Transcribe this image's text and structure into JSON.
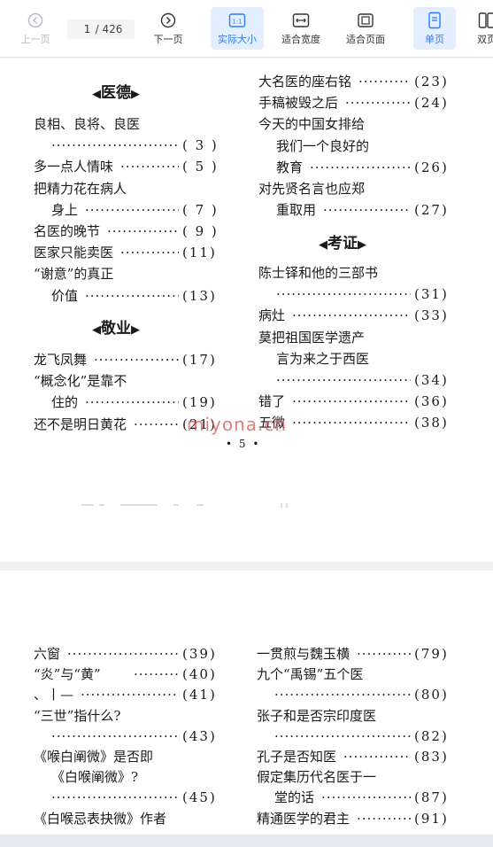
{
  "toolbar": {
    "prev_label": "上一页",
    "next_label": "下一页",
    "page_current": "1",
    "page_total": "/ 426",
    "actual_size_label": "实际大小",
    "fit_width_label": "适合宽度",
    "fit_page_label": "适合页面",
    "single_page_label": "单页",
    "double_page_label": "双页",
    "accent_color": "#2f7bf5"
  },
  "page1": {
    "left_col": {
      "heading_1": "医德",
      "entries_1": [
        {
          "title": "良相、良将、良医",
          "page": ""
        },
        {
          "title": "",
          "page": "( 3 )"
        },
        {
          "title": "多一点人情味",
          "page": "( 5 )"
        },
        {
          "title": "把精力花在病人",
          "page": ""
        },
        {
          "title": "身上",
          "page": "( 7 )"
        },
        {
          "title": "名医的晚节",
          "page": "( 9 )"
        },
        {
          "title": "医家只能卖医",
          "page": "(11)"
        },
        {
          "title": "“谢意”的真正",
          "page": ""
        },
        {
          "title": "价值",
          "page": "(13)"
        }
      ],
      "heading_2": "敬业",
      "entries_2": [
        {
          "title": "龙飞凤舞",
          "page": "(17)"
        },
        {
          "title": "“概念化”是靠不",
          "page": ""
        },
        {
          "title": "住的",
          "page": "(19)"
        },
        {
          "title": "还不是明日黄花",
          "page": "(21)"
        }
      ]
    },
    "right_col": {
      "entries_1": [
        {
          "title": "大名医的座右铭",
          "page": "(23)"
        },
        {
          "title": "手稿被毁之后",
          "page": "(24)"
        },
        {
          "title": "今天的中国女排给",
          "page": ""
        },
        {
          "title": "我们一个良好的",
          "page": ""
        },
        {
          "title": "教育",
          "page": "(26)"
        },
        {
          "title": "对先贤名言也应郑",
          "page": ""
        },
        {
          "title": "重取用",
          "page": "(27)"
        }
      ],
      "heading": "考证",
      "entries_2": [
        {
          "title": "陈士铎和他的三部书",
          "page": ""
        },
        {
          "title": "",
          "page": "(31)"
        },
        {
          "title": "病灶",
          "page": "(33)"
        },
        {
          "title": "莫把祖国医学遗产",
          "page": ""
        },
        {
          "title": "言为来之于西医",
          "page": ""
        },
        {
          "title": "",
          "page": "(34)"
        },
        {
          "title": "错了",
          "page": "(36)"
        },
        {
          "title": "五微",
          "page": "(38)"
        }
      ]
    },
    "page_number": "• 5 •",
    "watermark": "miyona.cn"
  },
  "page2": {
    "left_col": [
      {
        "title": "六窗",
        "page": "(39)"
      },
      {
        "title": "“炎”与“黄”",
        "page": "(40)"
      },
      {
        "title": "、丨—",
        "page": "(41)"
      },
      {
        "title": "“三世”指什么?",
        "page": ""
      },
      {
        "title": "",
        "page": "(43)"
      },
      {
        "title": "《喉白阐微》是否即",
        "page": ""
      },
      {
        "title": "《白喉阐微》?",
        "page": ""
      },
      {
        "title": "",
        "page": "(45)"
      },
      {
        "title": "《白喉忌表抉微》作者",
        "page": ""
      }
    ],
    "right_col": [
      {
        "title": "一贯煎与魏玉横",
        "page": "(79)"
      },
      {
        "title": "九个“禹锡”五个医",
        "page": ""
      },
      {
        "title": "",
        "page": "(80)"
      },
      {
        "title": "张子和是否宗印度医",
        "page": ""
      },
      {
        "title": "",
        "page": "(82)"
      },
      {
        "title": "孔子是否知医",
        "page": "(83)"
      },
      {
        "title": "假定集历代名医于一",
        "page": ""
      },
      {
        "title": "堂的话",
        "page": "(87)"
      },
      {
        "title": "精通医学的君主",
        "page": "(91)"
      }
    ]
  }
}
